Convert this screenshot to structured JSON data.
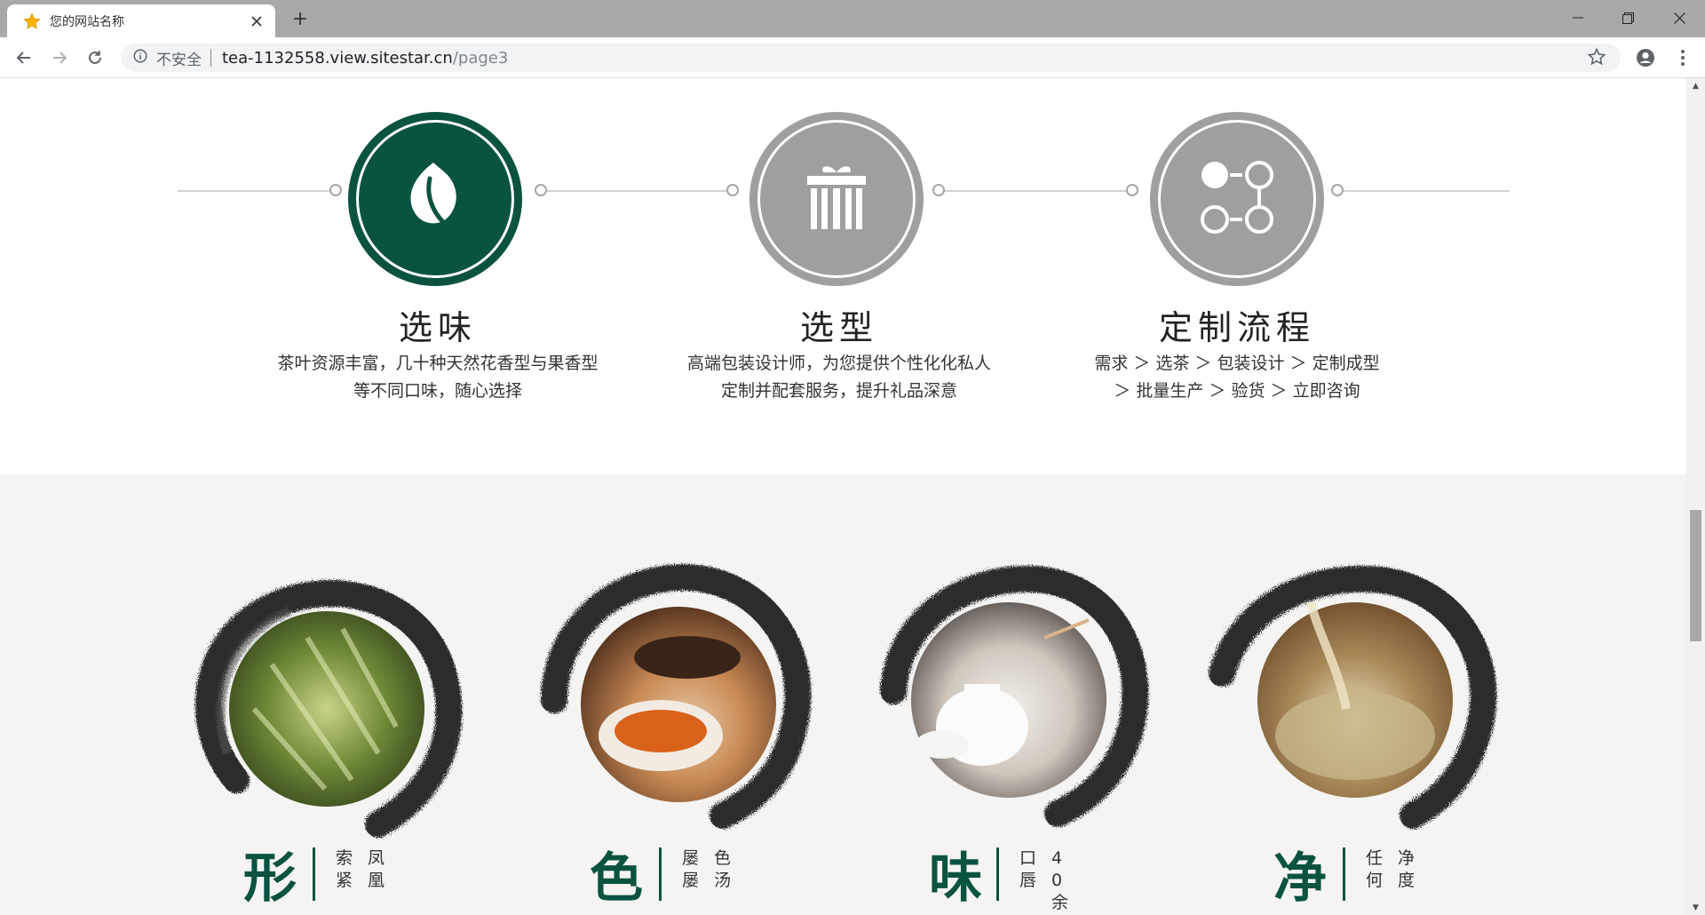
{
  "browser": {
    "tab_title": "您的网站名称",
    "secure_label": "不安全",
    "url_host": "tea-1132558.view.sitestar.cn",
    "url_path": "/page3"
  },
  "steps": [
    {
      "title": "选味",
      "desc_line1": "茶叶资源丰富，几十种天然花香型与果香型",
      "desc_line2": "等不同口味，随心选择",
      "icon": "leaf-icon",
      "active": true
    },
    {
      "title": "选型",
      "desc_line1": "高端包装设计师，为您提供个性化化私人",
      "desc_line2": "定制并配套服务，提升礼品深意",
      "icon": "gift-icon",
      "active": false
    },
    {
      "title": "定制流程",
      "desc_line1": "需求 ＞ 选茶 ＞ 包装设计 ＞ 定制成型",
      "desc_line2": "＞ 批量生产 ＞ 验货 ＞ 立即咨询",
      "icon": "nodes-icon",
      "active": false
    }
  ],
  "features": [
    {
      "char": "形",
      "col1": "索紧",
      "col2": "凤凰"
    },
    {
      "char": "色",
      "col1": "屡屡",
      "col2": "色汤"
    },
    {
      "char": "味",
      "col1": "口唇",
      "col2": "40余"
    },
    {
      "char": "净",
      "col1": "任何",
      "col2": "净度"
    }
  ],
  "colors": {
    "accent": "#0a5340",
    "gray_circle": "#a09e9e",
    "chrome": "#a8a8a8"
  }
}
